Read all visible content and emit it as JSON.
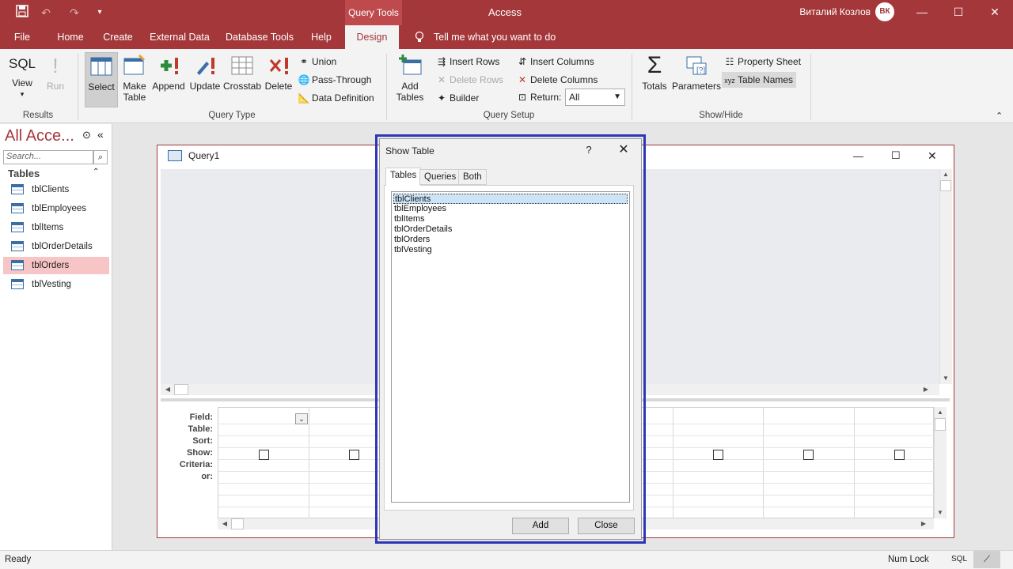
{
  "title_bar": {
    "context_tab": "Query Tools",
    "app_title": "Access",
    "user_name": "Виталий Козлов",
    "avatar_text": "ВК"
  },
  "menu": {
    "items": [
      "File",
      "Home",
      "Create",
      "External Data",
      "Database Tools",
      "Help",
      "Design"
    ],
    "active": "Design",
    "tell_me": "Tell me what you want to do"
  },
  "ribbon": {
    "results": {
      "label": "Results",
      "view": "View",
      "run": "Run",
      "sql": "SQL"
    },
    "query_type": {
      "label": "Query Type",
      "select": "Select",
      "make_table_1": "Make",
      "make_table_2": "Table",
      "append": "Append",
      "update": "Update",
      "crosstab": "Crosstab",
      "delete": "Delete",
      "union": "Union",
      "pass_through": "Pass-Through",
      "data_definition": "Data Definition"
    },
    "query_setup": {
      "label": "Query Setup",
      "add_tables_1": "Add",
      "add_tables_2": "Tables",
      "insert_rows": "Insert Rows",
      "delete_rows": "Delete Rows",
      "builder": "Builder",
      "insert_columns": "Insert Columns",
      "delete_columns": "Delete Columns",
      "return_label": "Return:",
      "return_value": "All"
    },
    "show_hide": {
      "label": "Show/Hide",
      "totals": "Totals",
      "parameters": "Parameters",
      "property_sheet": "Property Sheet",
      "table_names": "Table Names"
    }
  },
  "nav_pane": {
    "title": "All Acce...",
    "search_placeholder": "Search...",
    "section": "Tables",
    "items": [
      "tblClients",
      "tblEmployees",
      "tblItems",
      "tblOrderDetails",
      "tblOrders",
      "tblVesting"
    ],
    "selected": "tblOrders"
  },
  "query_window": {
    "title": "Query1",
    "grid_labels": [
      "Field:",
      "Table:",
      "Sort:",
      "Show:",
      "Criteria:",
      "or:"
    ]
  },
  "dialog": {
    "title": "Show Table",
    "help": "?",
    "tabs": [
      "Tables",
      "Queries",
      "Both"
    ],
    "active_tab": "Tables",
    "list": [
      "tblClients",
      "tblEmployees",
      "tblItems",
      "tblOrderDetails",
      "tblOrders",
      "tblVesting"
    ],
    "selected": "tblClients",
    "add": "Add",
    "close": "Close"
  },
  "status_bar": {
    "left": "Ready",
    "num_lock": "Num Lock",
    "sql": "SQL"
  },
  "colors": {
    "brand": "#a4373a",
    "dialog_highlight": "#2e36b8",
    "selected_nav": "#f7c5c5"
  }
}
